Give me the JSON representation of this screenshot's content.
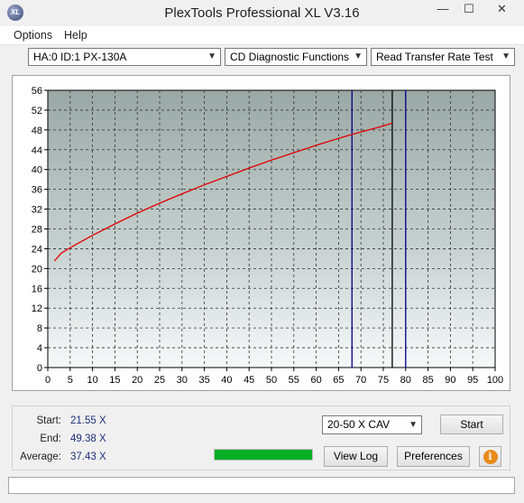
{
  "window": {
    "title": "PlexTools Professional XL V3.16",
    "logo_text": "XL",
    "minimize_glyph": "—",
    "maximize_glyph": "☐",
    "close_glyph": "✕"
  },
  "menu": {
    "items": [
      "Options",
      "Help"
    ]
  },
  "toolbar": {
    "drive": "HA:0 ID:1  PX-130A",
    "function": "CD Diagnostic Functions",
    "test": "Read Transfer Rate Test"
  },
  "chart_data": {
    "type": "line",
    "x_ticks": [
      0,
      5,
      10,
      15,
      20,
      25,
      30,
      35,
      40,
      45,
      50,
      55,
      60,
      65,
      70,
      75,
      80,
      85,
      90,
      95,
      100
    ],
    "y_ticks": [
      0,
      4,
      8,
      12,
      16,
      20,
      24,
      28,
      32,
      36,
      40,
      44,
      48,
      52,
      56
    ],
    "xlim": [
      0,
      100
    ],
    "ylim": [
      0,
      56
    ],
    "grid": true,
    "series": [
      {
        "color": "#e00000",
        "x": [
          1.5,
          3,
          5,
          10,
          15,
          20,
          25,
          30,
          35,
          40,
          45,
          50,
          55,
          60,
          65,
          70,
          75,
          77
        ],
        "y": [
          21.55,
          23.1,
          24.2,
          26.7,
          29.0,
          31.2,
          33.2,
          35.1,
          36.9,
          38.6,
          40.3,
          41.9,
          43.4,
          44.9,
          46.3,
          47.6,
          48.8,
          49.38
        ]
      }
    ],
    "markers": [
      {
        "x": 68,
        "color": "#00008b"
      },
      {
        "x": 77,
        "color": "#000000"
      },
      {
        "x": 80,
        "color": "#00008b"
      }
    ]
  },
  "stats": {
    "start_label": "Start:",
    "start_value": "21.55 X",
    "end_label": "End:",
    "end_value": "49.38 X",
    "average_label": "Average:",
    "average_value": "37.43 X"
  },
  "controls": {
    "speed": "20-50 X CAV",
    "start_button": "Start",
    "view_log_button": "View Log",
    "preferences_button": "Preferences",
    "info_glyph": "i",
    "progress": 1.0
  },
  "colors": {
    "accent_green": "#06b025",
    "line_red": "#e00000"
  }
}
